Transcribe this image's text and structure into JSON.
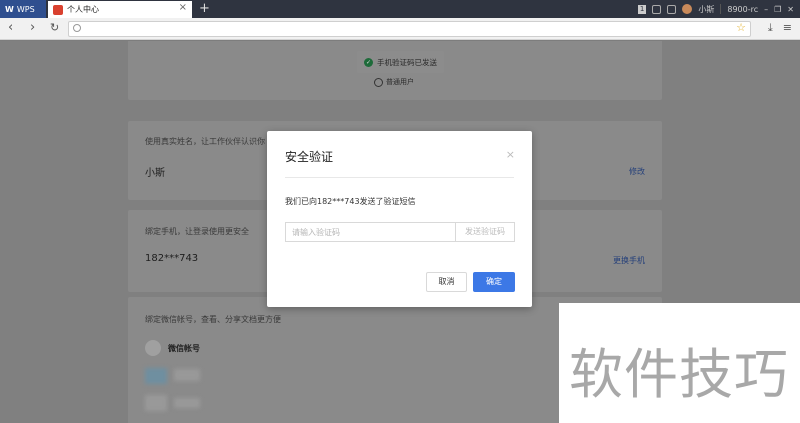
{
  "browser": {
    "wps_tab_label": "WPS",
    "active_tab_label": "个人中心",
    "tab_close": "×",
    "new_tab": "+",
    "badge_count": "1",
    "user_name": "小斯",
    "user_extra": "8900-rc",
    "nav_back": "‹",
    "nav_forward": "›",
    "nav_reload": "↻",
    "bookmark": "☆",
    "download": "⤓",
    "menu": "≡"
  },
  "page": {
    "user_type": "普通用户",
    "name_card": {
      "label": "使用真实姓名，让工作伙伴认识你",
      "value": "小斯",
      "action": "修改"
    },
    "phone_card": {
      "label": "绑定手机，让登录使用更安全",
      "value": "182***743",
      "action": "更换手机"
    },
    "wechat_card": {
      "label": "绑定微信帐号，查看、分享文档更方便",
      "account_label": "微信帐号"
    }
  },
  "toast": {
    "text": "手机验证码已发送",
    "icon": "check-circle-icon",
    "color": "#1e6b3a"
  },
  "dialog": {
    "title": "安全验证",
    "close": "×",
    "message": "我们已向182***743发送了验证短信",
    "code_placeholder": "请输入验证码",
    "send_code": "发送验证码",
    "cancel": "取消",
    "confirm": "确定",
    "confirm_color": "#3c78e6"
  },
  "watermark": {
    "text": "软件技巧"
  }
}
